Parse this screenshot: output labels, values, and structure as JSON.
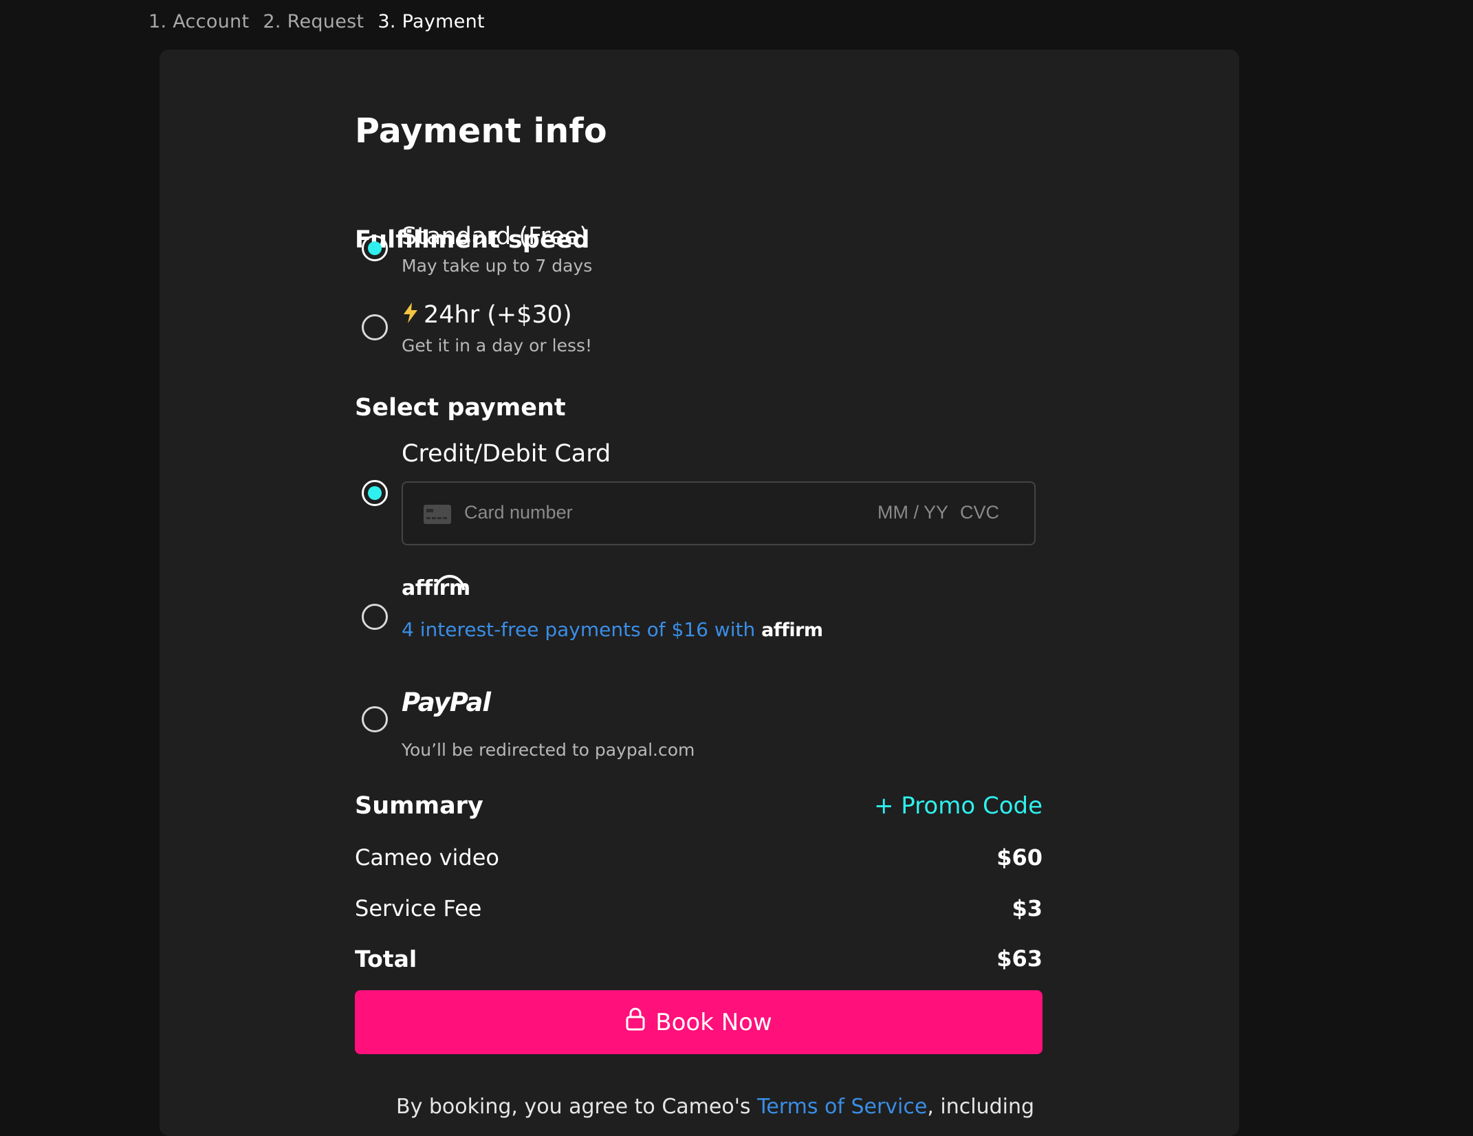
{
  "steps": [
    "1. Account",
    "2. Request",
    "3. Payment"
  ],
  "page_title": "Payment info",
  "fulfillment": {
    "heading": "Fulfillment speed",
    "options": [
      {
        "title": "Standard (Free)",
        "subtitle": "May take up to 7 days",
        "selected": true
      },
      {
        "title": "24hr (+$30)",
        "subtitle": "Get it in a day or less!",
        "selected": false,
        "icon": "lightning-bolt-icon"
      }
    ]
  },
  "payment": {
    "heading": "Select payment",
    "card": {
      "title": "Credit/Debit Card",
      "number_placeholder": "Card number",
      "expiry_placeholder": "MM / YY",
      "cvc_placeholder": "CVC",
      "selected": true
    },
    "affirm": {
      "logo": "affirm",
      "text": "4 interest-free payments of $16 with",
      "logo_inline": "affirm",
      "selected": false
    },
    "paypal": {
      "logo": "PayPal",
      "subtitle": "You’ll be redirected to paypal.com",
      "selected": false
    }
  },
  "summary": {
    "heading": "Summary",
    "promo_label": "+ Promo Code",
    "lines": [
      {
        "label": "Cameo video",
        "value": "$60"
      },
      {
        "label": "Service Fee",
        "value": "$3"
      }
    ],
    "total_label": "Total",
    "total_value": "$63"
  },
  "book_button": "Book Now",
  "terms": {
    "prefix": "By booking, you agree to Cameo's",
    "link": "Terms of Service",
    "suffix": ", including"
  },
  "colors": {
    "accent_cyan": "#2ff0ee",
    "book_pink": "#ff107b",
    "link_blue": "#3a8ee6",
    "bolt_yellow": "#f5c542"
  }
}
